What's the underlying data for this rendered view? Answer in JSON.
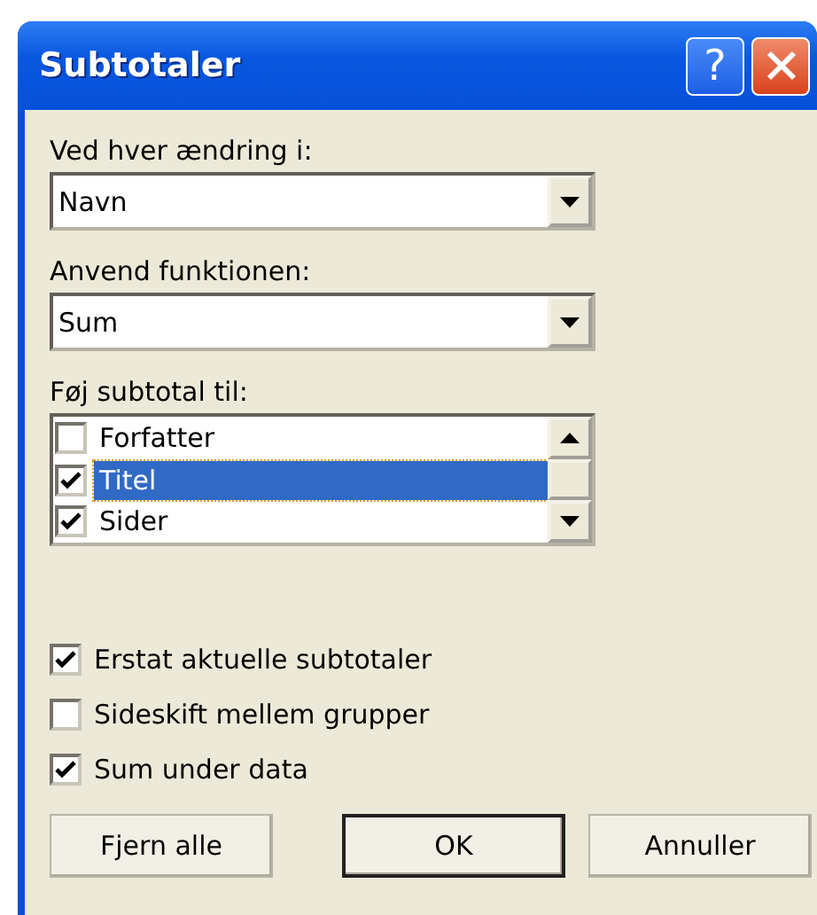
{
  "window": {
    "title": "Subtotaler",
    "title_buttons": [
      {
        "kind": "help",
        "label": "?"
      },
      {
        "kind": "close"
      }
    ]
  },
  "fields": [
    {
      "label": "Ved hver ændring i:",
      "value": "Navn"
    },
    {
      "label": "Anvend funktionen:",
      "value": "Sum"
    }
  ],
  "subtotal_list": {
    "label": "Føj subtotal til:",
    "items": [
      {
        "label": "Forfatter",
        "checked": false,
        "selected": false
      },
      {
        "label": "Titel",
        "checked": true,
        "selected": true
      },
      {
        "label": "Sider",
        "checked": true,
        "selected": false
      }
    ]
  },
  "options": [
    {
      "label": "Erstat aktuelle subtotaler",
      "checked": true
    },
    {
      "label": "Sideskift mellem grupper",
      "checked": false
    },
    {
      "label": "Sum under data",
      "checked": true
    }
  ],
  "buttons": [
    {
      "label": "Fjern alle",
      "default": false
    },
    {
      "label": "OK",
      "default": true
    },
    {
      "label": "Annuller",
      "default": false
    }
  ]
}
